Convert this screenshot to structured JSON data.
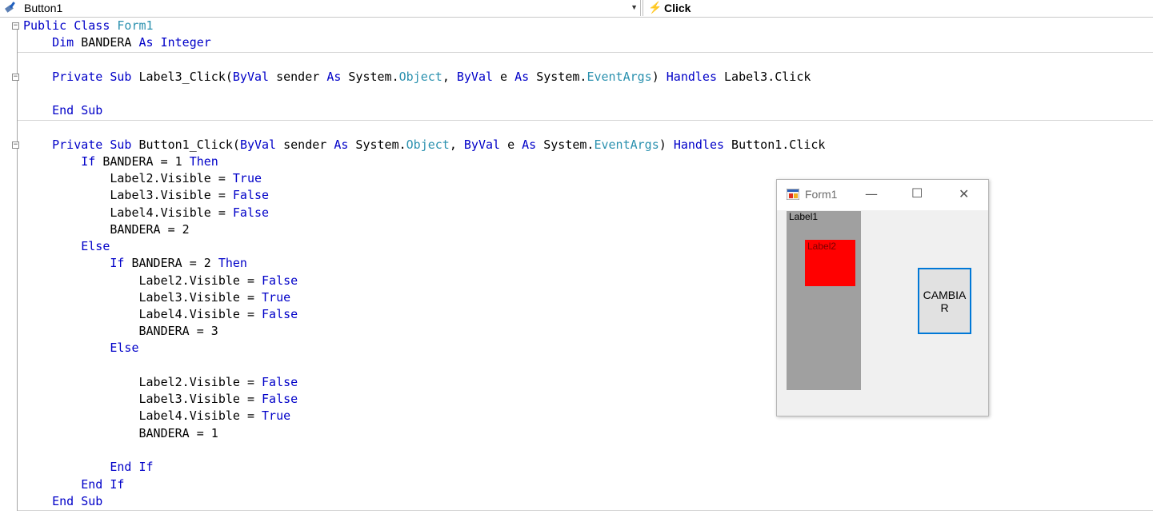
{
  "toolbar": {
    "object_combo": "Button1",
    "event_combo": "Click"
  },
  "code": {
    "lines": [
      [
        [
          "kw",
          "Public Class "
        ],
        [
          "tp",
          "Form1"
        ]
      ],
      [
        [
          "txt",
          "    "
        ],
        [
          "kw",
          "Dim"
        ],
        [
          "txt",
          " BANDERA "
        ],
        [
          "kw",
          "As Integer"
        ]
      ],
      [
        [
          "txt",
          ""
        ]
      ],
      [
        [
          "txt",
          "    "
        ],
        [
          "kw",
          "Private Sub"
        ],
        [
          "txt",
          " Label3_Click("
        ],
        [
          "kw",
          "ByVal"
        ],
        [
          "txt",
          " sender "
        ],
        [
          "kw",
          "As"
        ],
        [
          "txt",
          " System."
        ],
        [
          "tp",
          "Object"
        ],
        [
          "txt",
          ", "
        ],
        [
          "kw",
          "ByVal"
        ],
        [
          "txt",
          " e "
        ],
        [
          "kw",
          "As"
        ],
        [
          "txt",
          " System."
        ],
        [
          "tp",
          "EventArgs"
        ],
        [
          "txt",
          ") "
        ],
        [
          "kw",
          "Handles"
        ],
        [
          "txt",
          " Label3.Click"
        ]
      ],
      [
        [
          "txt",
          ""
        ]
      ],
      [
        [
          "txt",
          "    "
        ],
        [
          "kw",
          "End Sub"
        ]
      ],
      [
        [
          "txt",
          ""
        ]
      ],
      [
        [
          "txt",
          "    "
        ],
        [
          "kw",
          "Private Sub"
        ],
        [
          "txt",
          " Button1_Click("
        ],
        [
          "kw",
          "ByVal"
        ],
        [
          "txt",
          " sender "
        ],
        [
          "kw",
          "As"
        ],
        [
          "txt",
          " System."
        ],
        [
          "tp",
          "Object"
        ],
        [
          "txt",
          ", "
        ],
        [
          "kw",
          "ByVal"
        ],
        [
          "txt",
          " e "
        ],
        [
          "kw",
          "As"
        ],
        [
          "txt",
          " System."
        ],
        [
          "tp",
          "EventArgs"
        ],
        [
          "txt",
          ") "
        ],
        [
          "kw",
          "Handles"
        ],
        [
          "txt",
          " Button1.Click"
        ]
      ],
      [
        [
          "txt",
          "        "
        ],
        [
          "kw",
          "If"
        ],
        [
          "txt",
          " BANDERA = 1 "
        ],
        [
          "kw",
          "Then"
        ]
      ],
      [
        [
          "txt",
          "            Label2.Visible = "
        ],
        [
          "kw",
          "True"
        ]
      ],
      [
        [
          "txt",
          "            Label3.Visible = "
        ],
        [
          "kw",
          "False"
        ]
      ],
      [
        [
          "txt",
          "            Label4.Visible = "
        ],
        [
          "kw",
          "False"
        ]
      ],
      [
        [
          "txt",
          "            BANDERA = 2"
        ]
      ],
      [
        [
          "txt",
          "        "
        ],
        [
          "kw",
          "Else"
        ]
      ],
      [
        [
          "txt",
          "            "
        ],
        [
          "kw",
          "If"
        ],
        [
          "txt",
          " BANDERA = 2 "
        ],
        [
          "kw",
          "Then"
        ]
      ],
      [
        [
          "txt",
          "                Label2.Visible = "
        ],
        [
          "kw",
          "False"
        ]
      ],
      [
        [
          "txt",
          "                Label3.Visible = "
        ],
        [
          "kw",
          "True"
        ]
      ],
      [
        [
          "txt",
          "                Label4.Visible = "
        ],
        [
          "kw",
          "False"
        ]
      ],
      [
        [
          "txt",
          "                BANDERA = 3"
        ]
      ],
      [
        [
          "txt",
          "            "
        ],
        [
          "kw",
          "Else"
        ]
      ],
      [
        [
          "txt",
          ""
        ]
      ],
      [
        [
          "txt",
          "                Label2.Visible = "
        ],
        [
          "kw",
          "False"
        ]
      ],
      [
        [
          "txt",
          "                Label3.Visible = "
        ],
        [
          "kw",
          "False"
        ]
      ],
      [
        [
          "txt",
          "                Label4.Visible = "
        ],
        [
          "kw",
          "True"
        ]
      ],
      [
        [
          "txt",
          "                BANDERA = 1"
        ]
      ],
      [
        [
          "txt",
          ""
        ]
      ],
      [
        [
          "txt",
          "            "
        ],
        [
          "kw",
          "End If"
        ]
      ],
      [
        [
          "txt",
          "        "
        ],
        [
          "kw",
          "End If"
        ]
      ],
      [
        [
          "txt",
          "    "
        ],
        [
          "kw",
          "End Sub"
        ]
      ]
    ]
  },
  "form": {
    "title": "Form1",
    "label1": "Label1",
    "label2": "Label2",
    "button": "CAMBIAR",
    "minimize_glyph": "—",
    "maximize_glyph": "☐",
    "close_glyph": "✕"
  },
  "colors": {
    "keyword": "#0000c8",
    "type": "#2b91af",
    "button_border": "#0078d7",
    "label1_bg": "#a0a0a0",
    "label2_bg": "#ff0000"
  }
}
